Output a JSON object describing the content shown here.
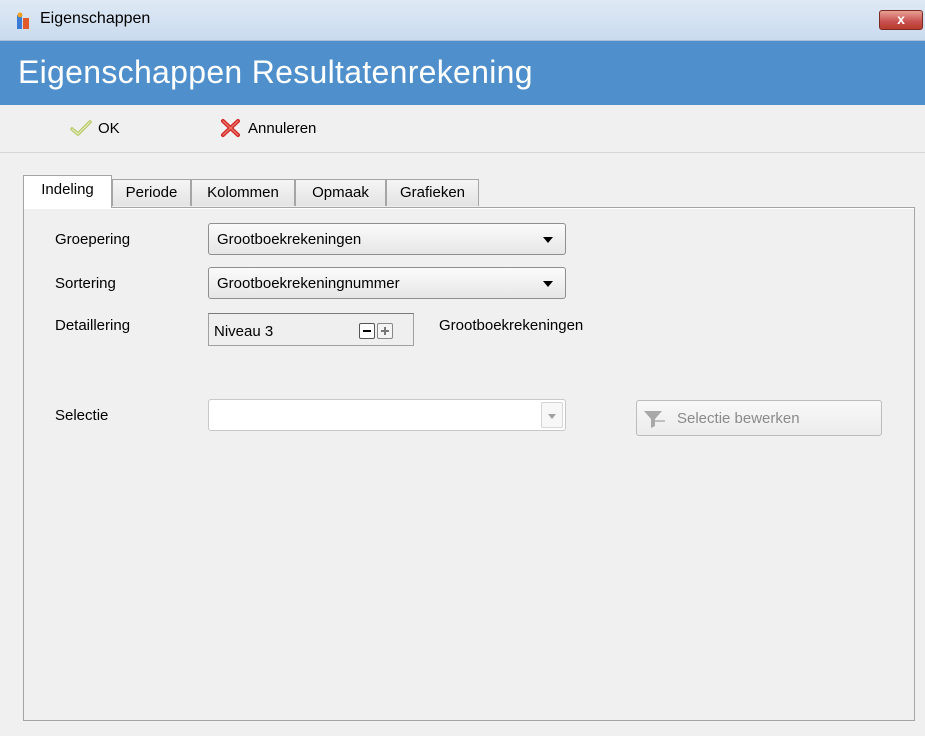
{
  "window": {
    "title": "Eigenschappen",
    "close_label": "x",
    "icon": "app-icon"
  },
  "header": {
    "title": "Eigenschappen Resultatenrekening"
  },
  "toolbar": {
    "ok_label": "OK",
    "ok_icon": "check-icon",
    "cancel_label": "Annuleren",
    "cancel_icon": "red-x-icon"
  },
  "tabs": [
    {
      "label": "Indeling",
      "active": true
    },
    {
      "label": "Periode",
      "active": false
    },
    {
      "label": "Kolommen",
      "active": false
    },
    {
      "label": "Opmaak",
      "active": false
    },
    {
      "label": "Grafieken",
      "active": false
    }
  ],
  "form": {
    "groepering": {
      "label": "Groepering",
      "value": "Grootboekrekeningen"
    },
    "sortering": {
      "label": "Sortering",
      "value": "Grootboekrekeningnummer"
    },
    "detaillering": {
      "label": "Detaillering",
      "value": "Niveau 3",
      "suffix": "Grootboekrekeningen"
    },
    "selectie": {
      "label": "Selectie",
      "value": "",
      "button_label": "Selectie bewerken",
      "button_icon": "funnel-icon",
      "enabled": false
    }
  },
  "colors": {
    "header_band": "#4f90cc",
    "titlebar": "#c9dbee",
    "close_button": "#c75050"
  }
}
